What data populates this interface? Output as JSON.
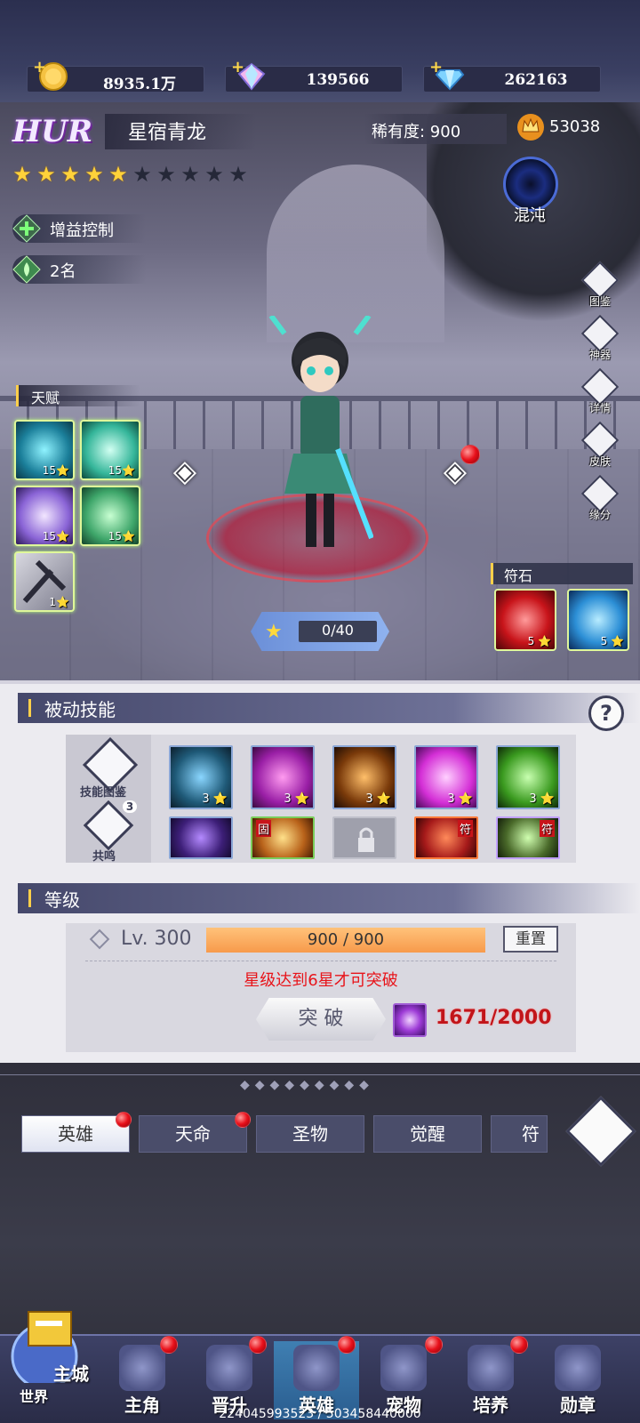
{
  "currencies": [
    {
      "icon": "gold-coin-icon",
      "value": "8935.1万"
    },
    {
      "icon": "rainbow-gem-icon",
      "value": "139566"
    },
    {
      "icon": "blue-diamond-icon",
      "value": "262163"
    }
  ],
  "hero": {
    "grade": "HUR",
    "name": "星宿青龙",
    "rarity_label": "稀有度: 900",
    "power": "53038",
    "stars_lit": 5,
    "stars_total": 10,
    "role": "增益控制",
    "rank": "2名",
    "element": "混沌"
  },
  "talents": {
    "label": "天赋",
    "items": [
      {
        "level": "15"
      },
      {
        "level": "15"
      },
      {
        "level": "15"
      },
      {
        "level": "15"
      },
      {
        "level": "1"
      }
    ]
  },
  "side_buttons": [
    "图鉴",
    "神器",
    "详情",
    "皮肤",
    "缘分"
  ],
  "runes": {
    "label": "符石",
    "items": [
      {
        "level": "5"
      },
      {
        "level": "5"
      }
    ]
  },
  "exp": "0/40",
  "passive_skills": {
    "title": "被动技能",
    "side_labels": [
      "技能图鉴",
      "共鸣"
    ],
    "resonance_count": "3",
    "row1": [
      {
        "level": "3"
      },
      {
        "level": "3"
      },
      {
        "level": "3"
      },
      {
        "level": "3"
      },
      {
        "level": "3"
      }
    ],
    "row2_badges": [
      "",
      "固",
      "",
      "符",
      "符"
    ]
  },
  "level": {
    "title": "等级",
    "lv_text": "Lv. 300",
    "bar_text": "900 / 900",
    "progress": 1.0,
    "reset_label": "重置",
    "warning": "星级达到6星才可突破",
    "break_label": "突 破",
    "material_count": "1671/2000"
  },
  "tabs": [
    "英雄",
    "天命",
    "圣物",
    "觉醒",
    "符文"
  ],
  "nav": {
    "city_labels": [
      "主城",
      "世界"
    ],
    "items": [
      "主角",
      "晋升",
      "英雄",
      "宠物",
      "培养",
      "勋章"
    ],
    "active": "英雄"
  },
  "footer_id": "2240459935​23 / 503458440000",
  "colors": {
    "accent": "#ffcf4a",
    "reddot": "#e8101a",
    "warning": "#e8141a"
  }
}
